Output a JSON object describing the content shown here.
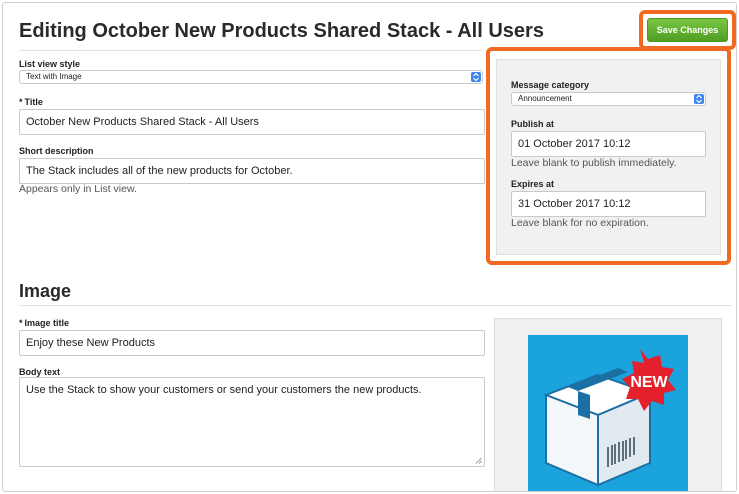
{
  "header": {
    "title": "Editing October New Products Shared Stack - All Users",
    "save_label": "Save Changes"
  },
  "form": {
    "list_view_style": {
      "label": "List view style",
      "value": "Text with Image"
    },
    "title": {
      "required_mark": "*",
      "label": "Title",
      "value": "October New Products Shared Stack - All Users"
    },
    "short_description": {
      "label": "Short description",
      "value": "The Stack includes all of the new products for October.",
      "help": "Appears only in List view."
    }
  },
  "side_panel": {
    "message_category": {
      "label": "Message category",
      "value": "Announcement"
    },
    "publish_at": {
      "label": "Publish at",
      "value": "01 October 2017 10:12",
      "help": "Leave blank to publish immediately."
    },
    "expires_at": {
      "label": "Expires at",
      "value": "31 October 2017 10:12",
      "help": "Leave blank for no expiration."
    }
  },
  "image_section": {
    "heading": "Image",
    "image_title": {
      "required_mark": "*",
      "label": "Image title",
      "value": "Enjoy these New Products"
    },
    "body_text": {
      "label": "Body text",
      "value": "Use the Stack to show your customers or send your customers the new products."
    },
    "thumbnail": {
      "icon": "box-icon",
      "badge_text": "NEW"
    }
  },
  "colors": {
    "highlight": "#f26a21",
    "save_green": "#5aab2a",
    "select_blue": "#3b86f0",
    "thumb_blue": "#1aa3dc",
    "badge_red": "#e3202c"
  }
}
